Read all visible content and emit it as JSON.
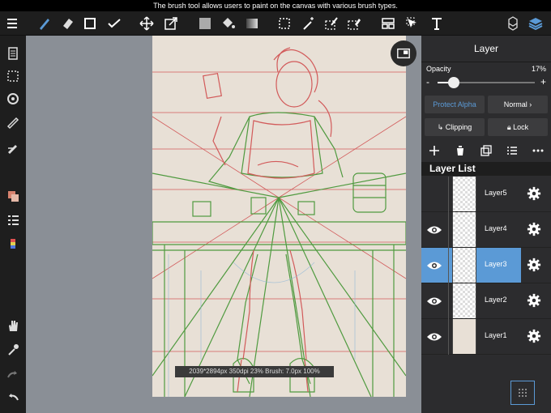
{
  "tooltip": "The brush tool allows users to paint on the canvas with various brush types.",
  "toolbar": {
    "tools": [
      "menu-icon",
      "brush-icon",
      "eraser-icon",
      "rectangle-icon",
      "filter-icon",
      "move-icon",
      "transform-icon",
      "fill-color-icon",
      "bucket-icon",
      "gradient-icon",
      "select-rect-icon",
      "magic-wand-icon",
      "select-pen-icon",
      "select-eraser-icon",
      "layout-icon",
      "select-move-icon",
      "text-icon",
      "material-icon",
      "layers-icon"
    ]
  },
  "left_tools": [
    "page-icon",
    "selection-icon",
    "rotate-icon",
    "ruler-icon",
    "snap-icon",
    "color-icon",
    "layer-list-icon",
    "palette-icon",
    "hand-icon",
    "eyedropper-icon",
    "redo-icon",
    "undo-icon"
  ],
  "colors": {
    "accent": "#5b9ad6",
    "panel": "#2c2c2e",
    "canvas_bg": "#8a8f96",
    "paper": "#e8e0d6",
    "green_line": "#4f9a3f",
    "red_line": "#d25a5a",
    "blue_line": "#8fb7d8"
  },
  "status": "2039*2894px 350dpi 23% Brush: 7.0px 100%",
  "panel": {
    "title": "Layer",
    "opacity_label": "Opacity",
    "opacity_value": "17%",
    "opacity_fraction": 0.17,
    "minus": "-",
    "plus": "+",
    "protect_alpha": "Protect Alpha",
    "blend_mode": "Normal",
    "clipping": "Clipping",
    "lock": "Lock",
    "list_header": "Layer List",
    "layers": [
      {
        "name": "Layer5",
        "visible": false,
        "selected": false
      },
      {
        "name": "Layer4",
        "visible": true,
        "selected": false
      },
      {
        "name": "Layer3",
        "visible": true,
        "selected": true
      },
      {
        "name": "Layer2",
        "visible": true,
        "selected": false
      },
      {
        "name": "Layer1",
        "visible": true,
        "selected": false
      }
    ]
  }
}
